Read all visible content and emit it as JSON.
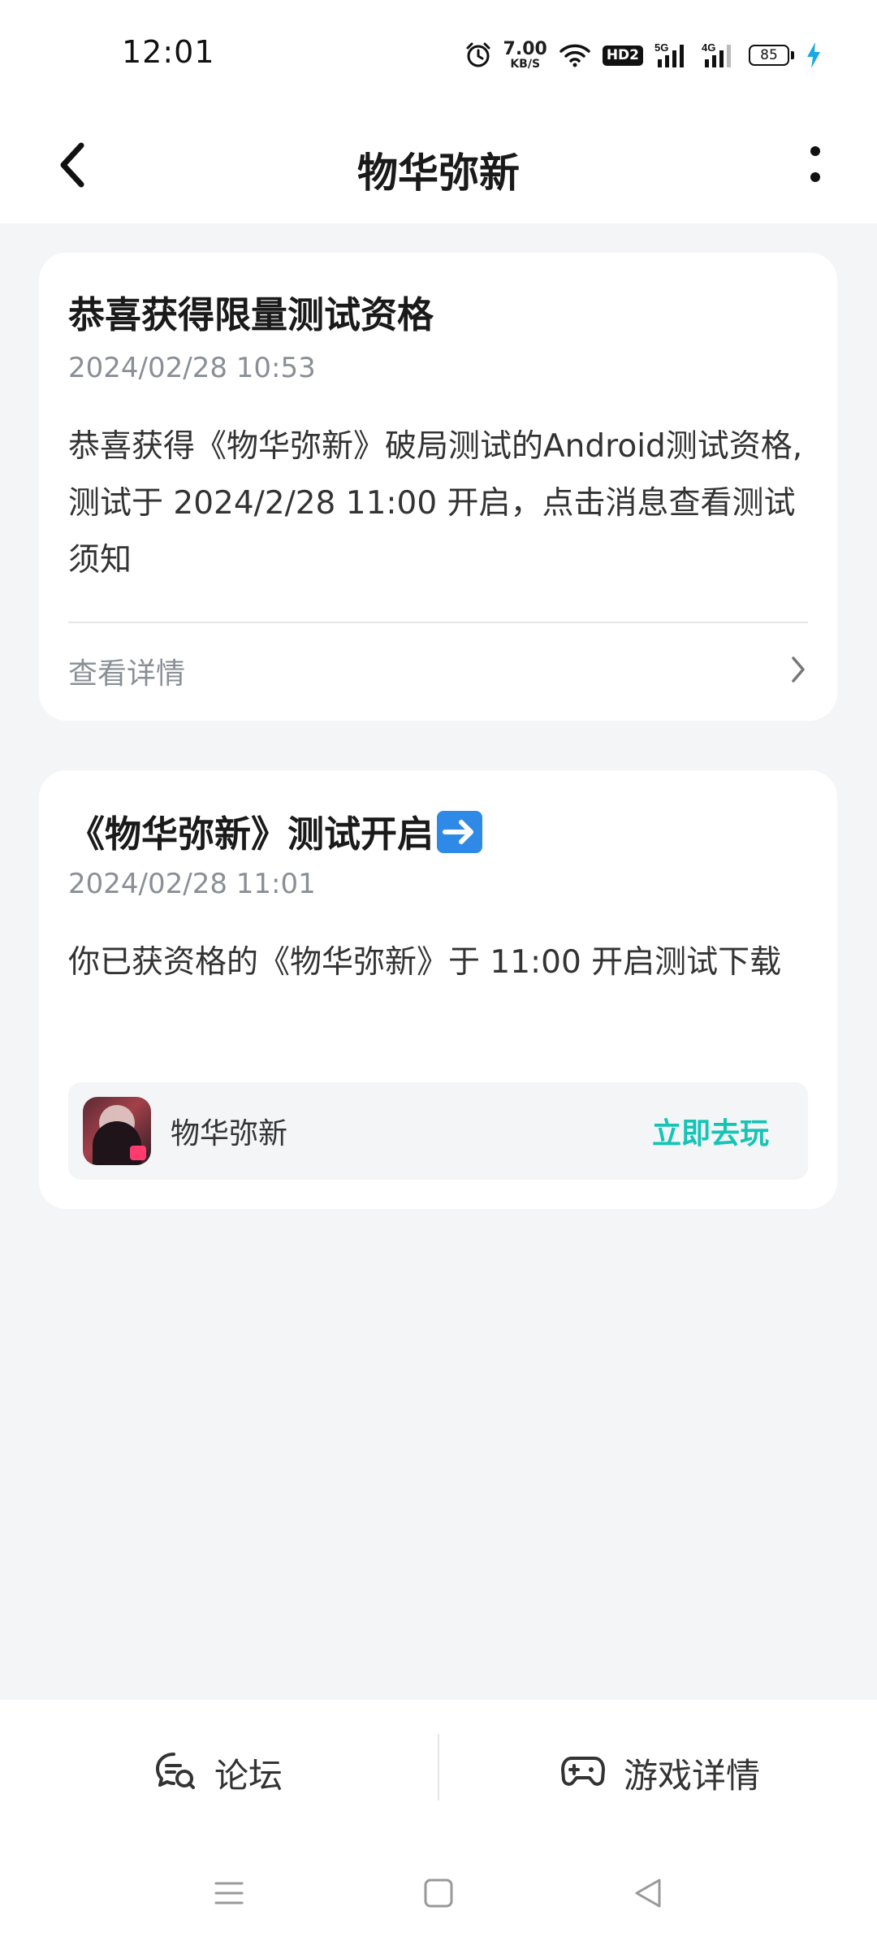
{
  "status_bar": {
    "time": "12:01",
    "net_speed_value": "7.00",
    "net_speed_unit": "KB/S",
    "hd_label": "HD2",
    "signal_1_label": "5G",
    "signal_2_label": "4G",
    "battery_level": "85",
    "icons": [
      "alarm-icon",
      "wifi-icon",
      "hd-icon",
      "signal-5g-icon",
      "signal-4g-icon",
      "battery-icon",
      "charging-icon"
    ]
  },
  "header": {
    "title": "物华弥新"
  },
  "messages": [
    {
      "title": "恭喜获得限量测试资格",
      "time": "2024/02/28 10:53",
      "body": "恭喜获得《物华弥新》破局测试的Android测试资格,测试于 2024/2/28 11:00 开启，点击消息查看测试须知",
      "action_label": "查看详情"
    },
    {
      "title": "《物华弥新》测试开启",
      "time": "2024/02/28 11:01",
      "body": "你已获资格的《物华弥新》于 11:00 开启测试下载",
      "game_name": "物华弥新",
      "play_label": "立即去玩"
    }
  ],
  "bottom_bar": {
    "forum_label": "论坛",
    "game_details_label": "游戏详情"
  },
  "colors": {
    "accent": "#14c4b5",
    "background": "#f4f5f7",
    "card": "#ffffff",
    "secondary_text": "#8a8f96"
  }
}
